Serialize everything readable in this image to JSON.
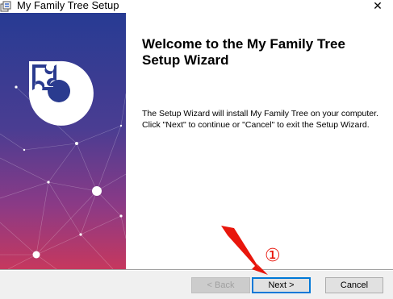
{
  "window": {
    "title": "My Family Tree Setup",
    "close_glyph": "✕",
    "icon": "installer-icon"
  },
  "side_panel": {
    "logo_icon": "puzzle-piece-logo-icon",
    "gradient_colors": [
      "#2a3b8f",
      "#6a3a8e",
      "#c2385e"
    ]
  },
  "main": {
    "heading": "Welcome to the My Family Tree Setup Wizard",
    "description": "The Setup Wizard will install My Family Tree on your computer.  Click \"Next\" to continue or \"Cancel\" to exit the Setup Wizard."
  },
  "buttons": {
    "back_label": "< Back",
    "back_enabled": false,
    "next_label": "Next >",
    "cancel_label": "Cancel"
  },
  "annotation": {
    "step_marker": "①",
    "color": "#e8160c"
  }
}
